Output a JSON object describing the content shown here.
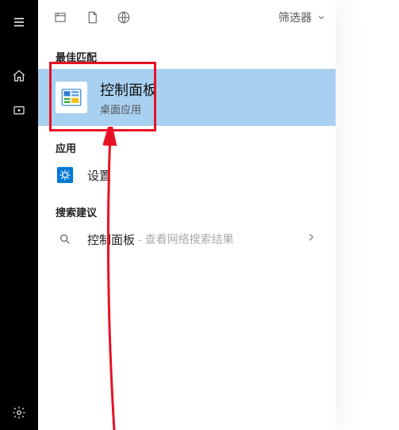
{
  "toolbar": {
    "filter_label": "筛选器"
  },
  "sections": {
    "best_match": "最佳匹配",
    "apps": "应用",
    "suggestions": "搜索建议"
  },
  "best_match": {
    "title": "控制面板",
    "subtitle": "桌面应用"
  },
  "apps": [
    {
      "label": "设置"
    }
  ],
  "suggestions": [
    {
      "text": "控制面板",
      "hint": " - 查看网络搜索结果"
    }
  ]
}
